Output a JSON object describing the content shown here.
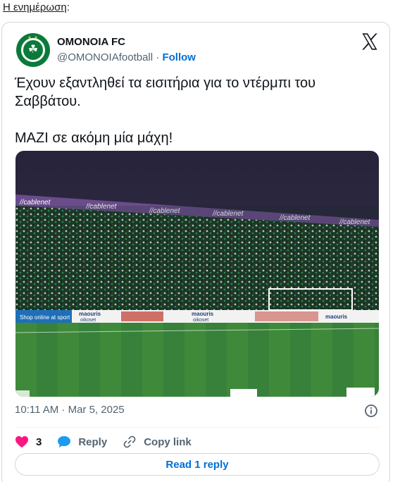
{
  "page": {
    "heading": "Η ενημέρωση",
    "heading_suffix": ":"
  },
  "tweet": {
    "author_name": "OMONOIA FC",
    "handle": "@OMONOIAfootball",
    "separator": " · ",
    "follow_label": "Follow",
    "text_line1": "Έχουν εξαντληθεί τα εισιτήρια για το ντέρμπι του Σαββάτου.",
    "text_line2": "ΜΑΖΙ σε ακόμη μία μάχη!",
    "photo_ads": {
      "cablenet": "//cablenet",
      "shop": "Shop online at sport",
      "maouris": "maouris",
      "oikoset": "oikoset"
    },
    "timestamp": "10:11 AM · Mar 5, 2025",
    "like_count": "3",
    "reply_label": "Reply",
    "copy_link_label": "Copy link",
    "read_replies_label": "Read 1 reply"
  },
  "colors": {
    "brand_green": "#0a7a3a",
    "like_red": "#f91880",
    "reply_blue": "#1d9bf0",
    "link_blue": "#006fd6"
  },
  "icons": {
    "platform": "x-logo-icon",
    "info": "info-icon",
    "like": "heart-icon",
    "reply": "speech-bubble-icon",
    "copy": "link-icon"
  }
}
